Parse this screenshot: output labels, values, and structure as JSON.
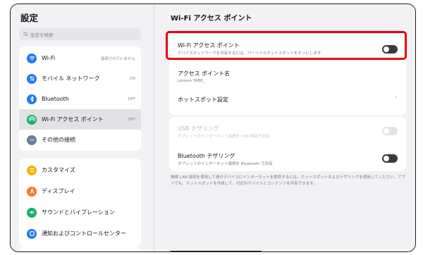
{
  "left": {
    "title": "設定",
    "search_placeholder": "設定を検索",
    "group1": [
      {
        "label": "Wi-Fi",
        "value": "接続されていません",
        "icon": "wifi-icon",
        "color": "#1e7cf2"
      },
      {
        "label": "モバイル ネットワーク",
        "value": "ON",
        "icon": "mobile-network-icon",
        "color": "#1e7cf2"
      },
      {
        "label": "Bluetooth",
        "value": "OFF",
        "icon": "bluetooth-icon",
        "color": "#1e7cf2"
      },
      {
        "label": "Wi-Fi アクセス ポイント",
        "value": "OFF",
        "icon": "hotspot-icon",
        "color": "#17b06a"
      },
      {
        "label": "その他の接続",
        "value": "",
        "icon": "more-connections-icon",
        "color": "#6e7e9b"
      }
    ],
    "group2": [
      {
        "label": "カスタマイズ",
        "icon": "customize-icon",
        "color": "#f4b400"
      },
      {
        "label": "ディスプレイ",
        "icon": "display-icon",
        "color": "#f47a20"
      },
      {
        "label": "サウンドとバイブレーション",
        "icon": "sound-icon",
        "color": "#17b06a"
      },
      {
        "label": "通知およびコントロールセンター",
        "icon": "notification-icon",
        "color": "#1e7cf2"
      }
    ]
  },
  "right": {
    "title": "Wi-Fi アクセス ポイント",
    "hotspot": {
      "title": "Wi-Fi アクセス ポイント",
      "subtitle": "デバイスネットワークを共有するには、パーソナルホットスポットをオンにします"
    },
    "ap_name": {
      "title": "アクセス ポイント名",
      "value": "Lenovo TAB8_"
    },
    "hotspot_settings": {
      "title": "ホットスポット設定",
      "chevron": "›"
    },
    "usb": {
      "title": "USB テザリング",
      "subtitle": "タブレットのインターネット接続を USB 経由で共有"
    },
    "bt": {
      "title": "Bluetooth テザリング",
      "subtitle": "タブレットのインターネット接続を Bluetooth で共有"
    },
    "footnote": "無線 LAN 接続を使用して他のデバイスにインターネットを提供するには、ホットスポットおよびテザリングを使用してください。アプリでも、ホットスポットを作成して、付近のデバイスとコンテンツを共有できます。"
  },
  "colors": {
    "highlight": "#e60012",
    "toggle_off": "#3a3a3c"
  }
}
